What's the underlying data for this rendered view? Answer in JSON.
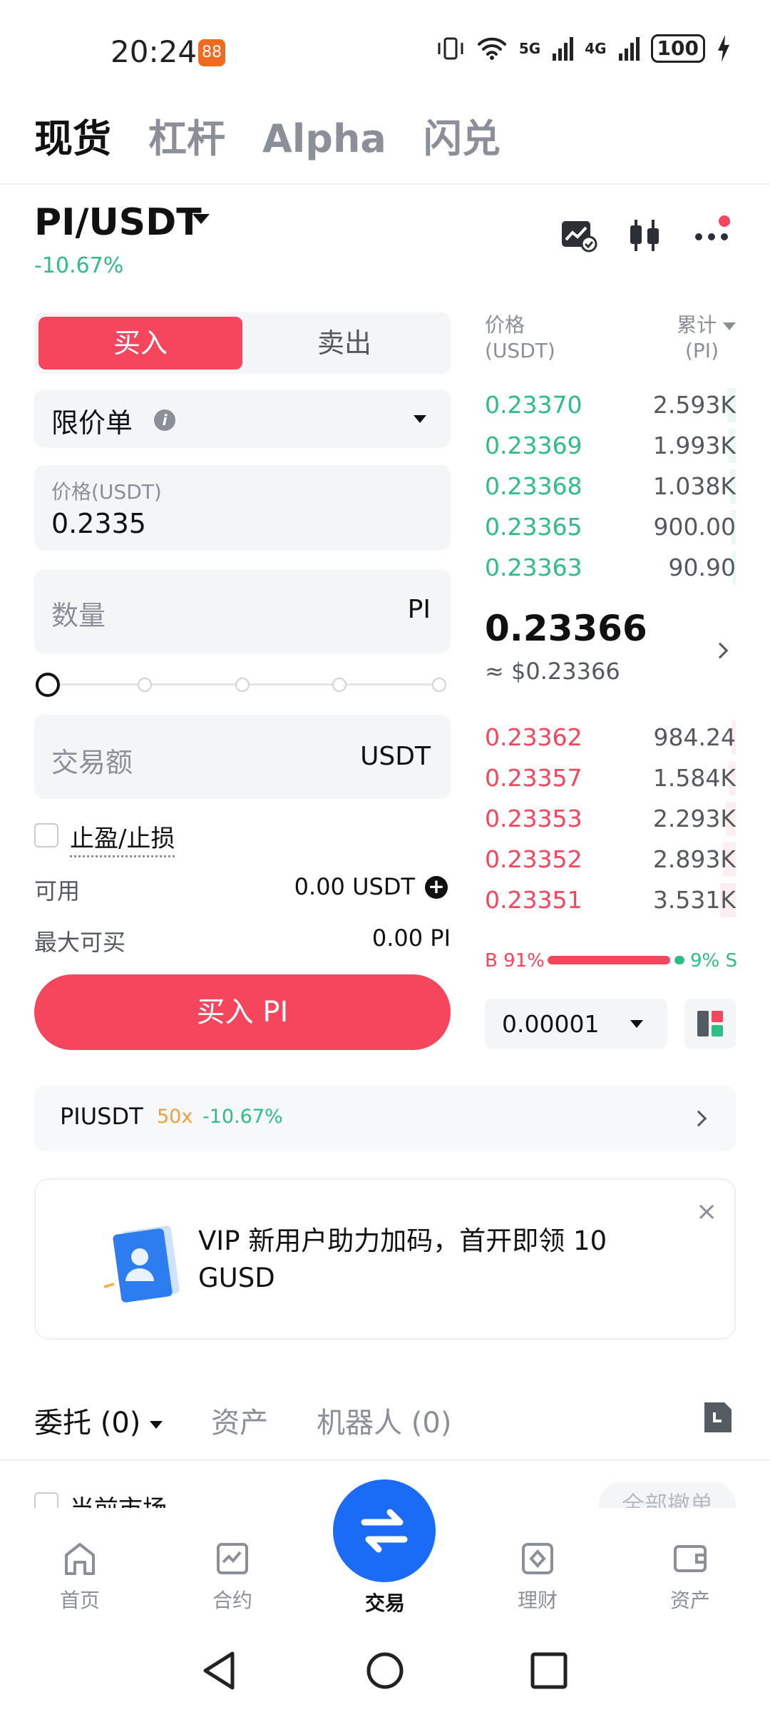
{
  "status_bar": {
    "time": "20:24",
    "app_badge": "88",
    "net1": "5G",
    "net2": "4G",
    "battery": "100"
  },
  "top_tabs": [
    "现货",
    "杠杆",
    "Alpha",
    "闪兑"
  ],
  "pair": {
    "symbol": "PI/USDT",
    "change": "-10.67%"
  },
  "trade_form": {
    "buy_label": "买入",
    "sell_label": "卖出",
    "order_type": "限价单",
    "price_label": "价格(USDT)",
    "price_value": "0.2335",
    "qty_placeholder": "数量",
    "qty_unit": "PI",
    "amount_placeholder": "交易额",
    "amount_unit": "USDT",
    "tpsl_label": "止盈/止损",
    "available_label": "可用",
    "available_value": "0.00 USDT",
    "max_buy_label": "最大可买",
    "max_buy_value": "0.00 PI",
    "submit_label": "买入 PI"
  },
  "order_book": {
    "price_header": "价格",
    "price_unit": "(USDT)",
    "qty_header": "累计",
    "qty_unit": "(PI)",
    "asks": [
      {
        "price": "0.23370",
        "qty": "2.593K"
      },
      {
        "price": "0.23369",
        "qty": "1.993K"
      },
      {
        "price": "0.23368",
        "qty": "1.038K"
      },
      {
        "price": "0.23365",
        "qty": "900.00"
      },
      {
        "price": "0.23363",
        "qty": "90.90"
      }
    ],
    "last_price": "0.23366",
    "last_price_usd": "≈ $0.23366",
    "bids": [
      {
        "price": "0.23362",
        "qty": "984.24"
      },
      {
        "price": "0.23357",
        "qty": "1.584K"
      },
      {
        "price": "0.23353",
        "qty": "2.293K"
      },
      {
        "price": "0.23352",
        "qty": "2.893K"
      },
      {
        "price": "0.23351",
        "qty": "3.531K"
      }
    ],
    "buy_ratio_label": "B 91%",
    "sell_ratio_label": "9% S",
    "buy_ratio": 0.91,
    "depth_value": "0.00001"
  },
  "perp": {
    "name": "PIUSDT",
    "leverage": "50x",
    "change": "-10.67%"
  },
  "vip_banner": {
    "text": "VIP 新用户助力加码，首开即领 10 GUSD",
    "close": "×"
  },
  "bottom_tabs": {
    "orders": "委托 (0)",
    "assets": "资产",
    "bots": "机器人 (0)"
  },
  "orders_panel": {
    "current_market": "当前市场",
    "cancel_all": "全部撤单"
  },
  "bottom_nav": [
    {
      "label": "首页",
      "icon": "home-icon"
    },
    {
      "label": "合约",
      "icon": "futures-icon"
    },
    {
      "label": "交易",
      "icon": "trade-icon"
    },
    {
      "label": "理财",
      "icon": "earn-icon"
    },
    {
      "label": "资产",
      "icon": "wallet-icon"
    }
  ],
  "colors": {
    "buy": "#f6465d",
    "sell": "#2ebd85",
    "accent": "#1a6bf5"
  }
}
